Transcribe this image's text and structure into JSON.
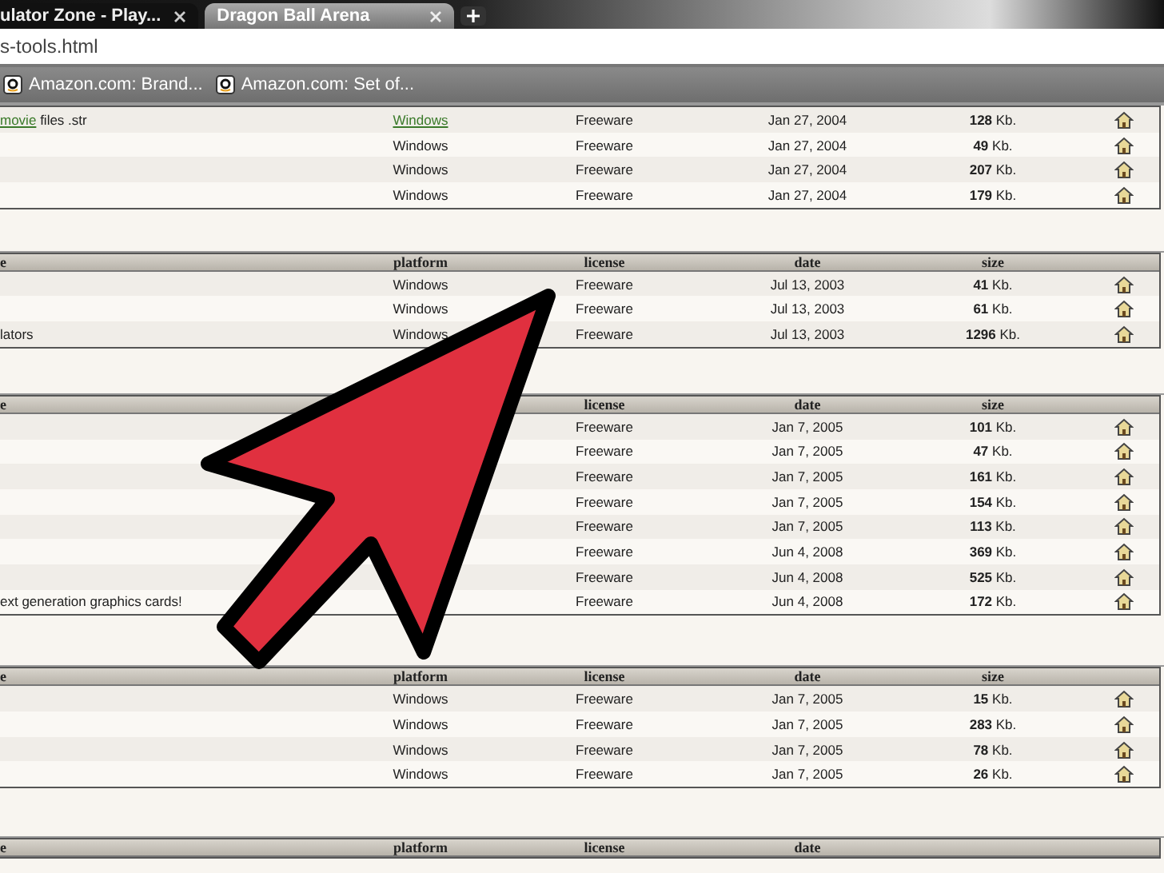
{
  "tabs": [
    {
      "label": "ulator Zone - Play...",
      "selected": true
    },
    {
      "label": "Dragon Ball Arena",
      "selected": false
    }
  ],
  "address": "s-tools.html",
  "bookmarks": [
    {
      "label": "Amazon.com: Brand..."
    },
    {
      "label": "Amazon.com: Set of..."
    }
  ],
  "tables": [
    {
      "rows": [
        {
          "name_link": "movie",
          "name": "files .str",
          "platform": "Windows",
          "platform_link": true,
          "license": "Freeware",
          "date": "Jan 27, 2004",
          "size": "**128** Kb."
        },
        {
          "platform": "Windows",
          "platform_link": false,
          "license": "Freeware",
          "date": "Jan 27, 2004",
          "size": "**49** Kb."
        },
        {
          "platform": "Windows",
          "platform_link": false,
          "license": "Freeware",
          "date": "Jan 27, 2004",
          "size": "**207** Kb."
        },
        {
          "platform": "Windows",
          "platform_link": false,
          "license": "Freeware",
          "date": "Jan 27, 2004",
          "size": "**179** Kb."
        }
      ]
    },
    {
      "header": {
        "name": "e",
        "platform": "platform",
        "license": "license",
        "date": "date",
        "size": "size"
      },
      "rows": [
        {
          "platform": "Windows",
          "platform_link": false,
          "license": "Freeware",
          "date": "Jul 13, 2003",
          "size": "**41** Kb."
        },
        {
          "platform": "Windows",
          "platform_link": false,
          "license": "Freeware",
          "date": "Jul 13, 2003",
          "size": "**61** Kb."
        },
        {
          "name": "lators",
          "platform": "Windows",
          "platform_link": false,
          "license": "Freeware",
          "date": "Jul 13, 2003",
          "size": "**1296** Kb."
        }
      ]
    },
    {
      "header": {
        "name": "e",
        "license": "license",
        "date": "date",
        "size": "size"
      },
      "rows": [
        {
          "license": "Freeware",
          "date": "Jan 7, 2005",
          "size": "**101** Kb."
        },
        {
          "license": "Freeware",
          "date": "Jan 7, 2005",
          "size": "**47** Kb."
        },
        {
          "license": "Freeware",
          "date": "Jan 7, 2005",
          "size": "**161** Kb."
        },
        {
          "license": "Freeware",
          "date": "Jan 7, 2005",
          "size": "**154** Kb."
        },
        {
          "license": "Freeware",
          "date": "Jan 7, 2005",
          "size": "**113** Kb."
        },
        {
          "license": "Freeware",
          "date": "Jun 4, 2008",
          "size": "**369** Kb."
        },
        {
          "license": "Freeware",
          "date": "Jun 4, 2008",
          "size": "**525** Kb."
        },
        {
          "name": "ext generation graphics cards!",
          "license": "Freeware",
          "date": "Jun 4, 2008",
          "size": "**172** Kb."
        }
      ]
    },
    {
      "header": {
        "name": "e",
        "platform": "platform",
        "license": "license",
        "date": "date",
        "size": "size"
      },
      "rows": [
        {
          "platform": "Windows",
          "platform_link": false,
          "license": "Freeware",
          "date": "Jan 7, 2005",
          "size": "**15** Kb."
        },
        {
          "platform": "Windows",
          "platform_link": false,
          "license": "Freeware",
          "date": "Jan 7, 2005",
          "size": "**283** Kb."
        },
        {
          "platform": "Windows",
          "platform_link": false,
          "license": "Freeware",
          "date": "Jan 7, 2005",
          "size": "**78** Kb."
        },
        {
          "platform": "Windows",
          "platform_link": false,
          "license": "Freeware",
          "date": "Jan 7, 2005",
          "size": "**26** Kb."
        }
      ]
    },
    {
      "header": {
        "name": "e",
        "platform": "platform",
        "license": "license",
        "date": "date"
      }
    }
  ]
}
